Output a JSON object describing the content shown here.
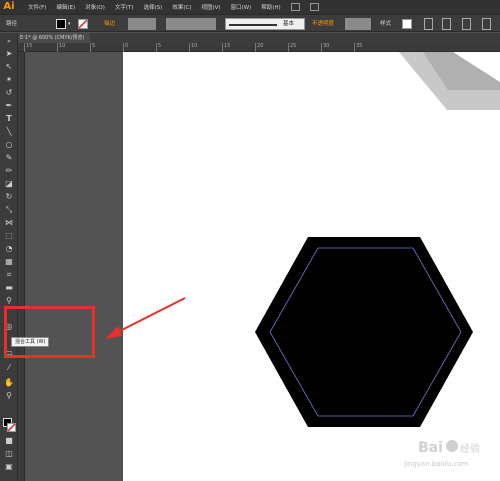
{
  "app": {
    "logo": "Ai"
  },
  "menu": [
    "文件(F)",
    "编辑(E)",
    "对象(O)",
    "文字(T)",
    "选择(S)",
    "效果(C)",
    "视图(V)",
    "窗口(W)",
    "帮助(H)"
  ],
  "control_bar": {
    "selection_label": "路径",
    "stroke_label": "描边",
    "stroke_style": "基本",
    "opacity_label": "不透明度",
    "style_label": "样式"
  },
  "document_tab": {
    "title": "E-1* @ 600% (CMYK/预览)"
  },
  "ruler": {
    "ticks": [
      "15",
      "10",
      "5",
      "0",
      "5",
      "10",
      "15",
      "20",
      "25",
      "30",
      "35"
    ]
  },
  "tooltip": {
    "text": "混合工具 (W)"
  },
  "colors": {
    "accent": "#ff9a00",
    "highlight": "#e8302a",
    "path_outline": "#6b7bd6"
  },
  "watermark": {
    "text": "jingyan.baidu.com"
  }
}
